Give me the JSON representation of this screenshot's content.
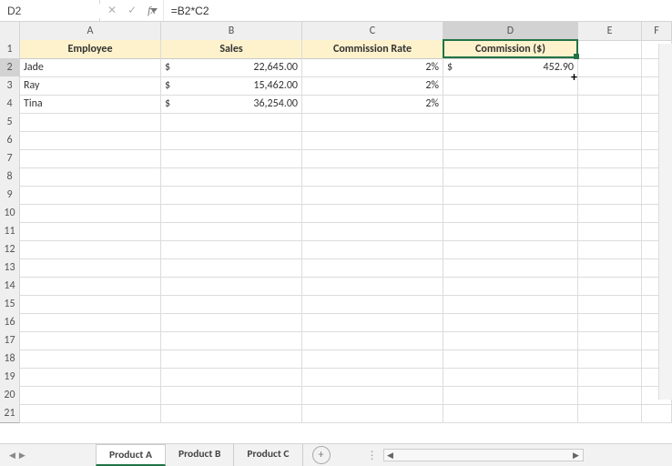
{
  "formula_bar": {
    "name_box": "D2",
    "formula": "=B2*C2"
  },
  "columns": [
    "A",
    "B",
    "C",
    "D",
    "E",
    "F"
  ],
  "headers": {
    "A": "Employee",
    "B": "Sales",
    "C": "Commission Rate",
    "D": "Commission ($)"
  },
  "rows": [
    {
      "emp": "Jade",
      "sales_sym": "$",
      "sales": "22,645.00",
      "rate": "2%",
      "comm_sym": "$",
      "comm": "452.90"
    },
    {
      "emp": "Ray",
      "sales_sym": "$",
      "sales": "15,462.00",
      "rate": "2%",
      "comm_sym": "",
      "comm": ""
    },
    {
      "emp": "Tina",
      "sales_sym": "$",
      "sales": "36,254.00",
      "rate": "2%",
      "comm_sym": "",
      "comm": ""
    }
  ],
  "blank_rows": 17,
  "selection": {
    "cell": "D2"
  },
  "tabs": {
    "items": [
      "Product A",
      "Product B",
      "Product C"
    ],
    "active": 0
  },
  "icons": {
    "cancel": "✕",
    "enter": "✓",
    "fx": "fx",
    "add": "+"
  }
}
